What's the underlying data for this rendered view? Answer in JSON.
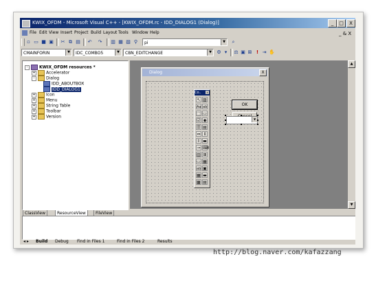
{
  "window": {
    "title": "KWIX_OFDM - Microsoft Visual C++ - [KWIX_OFDM.rc - IDD_DIALOG1 (Dialog)]",
    "minimize": "_",
    "maximize": "□",
    "close": "X"
  },
  "menu": {
    "items": [
      "File",
      "Edit",
      "View",
      "Insert",
      "Project",
      "Build",
      "Layout",
      "Tools",
      "Window",
      "Help"
    ],
    "mdi_controls": "_ & X"
  },
  "toolbar": {
    "find_combo": "pi",
    "class_combo": "CMAINFORIN",
    "id_combo": "IDC_COMBO5",
    "message_combo": "CBN_EDITCHANGE"
  },
  "tree": {
    "root": "KWIX_OFDM resources *",
    "items": [
      {
        "label": "Accelerator",
        "type": "folder",
        "expander": "+"
      },
      {
        "label": "Dialog",
        "type": "folder",
        "expander": "-"
      },
      {
        "label": "IDD_ABOUTBOX",
        "type": "dialog"
      },
      {
        "label": "IDD_DIALOG1",
        "type": "dialog",
        "selected": true
      },
      {
        "label": "Icon",
        "type": "folder",
        "expander": "+"
      },
      {
        "label": "Menu",
        "type": "folder",
        "expander": "+"
      },
      {
        "label": "String Table",
        "type": "folder",
        "expander": "+"
      },
      {
        "label": "Toolbar",
        "type": "folder",
        "expander": "+"
      },
      {
        "label": "Version",
        "type": "folder",
        "expander": "+"
      }
    ]
  },
  "workspace_tabs": [
    "ClassView",
    "ResourceView",
    "FileView"
  ],
  "dialog": {
    "title": "Dialog",
    "close": "X",
    "ok_label": "OK",
    "cancel_label": "Cancel"
  },
  "controls_toolbox": {
    "title": "Co..",
    "close": "x",
    "icons": [
      "pointer",
      "picture",
      "Aa",
      "ab|",
      "[xy]",
      "btn",
      "checkbox",
      "radio",
      "combobox",
      "listbox",
      "hscroll",
      "vscroll",
      "spin",
      "progress",
      "slider",
      "hotkey",
      "listctrl",
      "treectrl",
      "tabctrl",
      "animate",
      "richedit",
      "datetime",
      "monthcal",
      "ipaddr",
      "custom",
      "extcombo"
    ]
  },
  "output_tabs": [
    "Build",
    "Debug",
    "Find in Files 1",
    "Find in Files 2",
    "Results"
  ],
  "watermark": "http://blog.naver.com/kafazzang",
  "colors": {
    "titlebar_start": "#0a246a",
    "titlebar_end": "#a6caf0",
    "face": "#d4d0c8",
    "workspace": "#808080"
  }
}
